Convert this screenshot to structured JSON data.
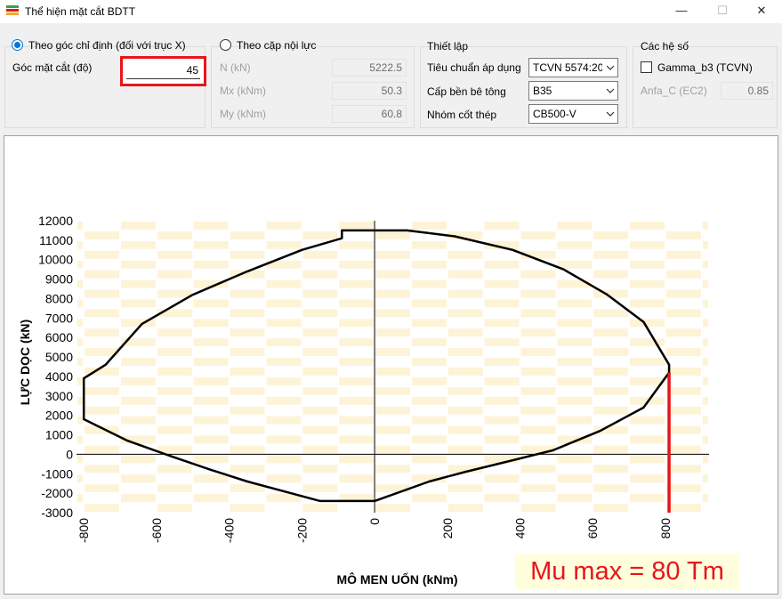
{
  "window": {
    "title": "Thể hiện mặt cắt BDTT",
    "minimize": "—",
    "maximize": "☐",
    "close": "✕"
  },
  "angle_group": {
    "radio_label": "Theo góc chỉ định (đối với trục X)",
    "selected": true,
    "angle_label": "Góc mặt cắt (độ)",
    "angle_value": "45"
  },
  "force_group": {
    "radio_label": "Theo cặp nội lực",
    "selected": false,
    "fields": [
      {
        "label": "N (kN)",
        "value": "5222.5"
      },
      {
        "label": "Mx (kNm)",
        "value": "50.3"
      },
      {
        "label": "My (kNm)",
        "value": "60.8"
      }
    ]
  },
  "settings_group": {
    "title": "Thiết lập",
    "rows": [
      {
        "label": "Tiêu chuẩn áp dụng",
        "value": "TCVN 5574:20"
      },
      {
        "label": "Cấp bền bê tông",
        "value": "B35"
      },
      {
        "label": "Nhóm cốt thép",
        "value": "CB500-V"
      }
    ]
  },
  "coeff_group": {
    "title": "Các hệ số",
    "checkbox_label": "Gamma_b3 (TCVN)",
    "checked": false,
    "anfa_label": "Anfa_C (EC2)",
    "anfa_value": "0.85"
  },
  "chart_data": {
    "type": "line",
    "xlabel": "MÔ MEN UỐN (kNm)",
    "ylabel": "LỰC DỌC (kN)",
    "xlim": [
      -820,
      920
    ],
    "ylim": [
      -3000,
      12000
    ],
    "xticks": [
      "-800",
      "-600",
      "-400",
      "-200",
      "0",
      "200",
      "400",
      "600",
      "800"
    ],
    "yticks": [
      "12000",
      "11000",
      "10000",
      "9000",
      "8000",
      "7000",
      "6000",
      "5000",
      "4000",
      "3000",
      "2000",
      "1000",
      "0",
      "-1000",
      "-2000",
      "-3000"
    ],
    "grid": true,
    "series": [
      {
        "x": [
          -90,
          90,
          220,
          380,
          520,
          640,
          740,
          810,
          810,
          740,
          620,
          490,
          360,
          250,
          150,
          0,
          -150,
          -250,
          -350,
          -450,
          -560,
          -680,
          -800,
          -800,
          -740,
          -640,
          -500,
          -350,
          -200,
          -90
        ],
        "y": [
          11500,
          11500,
          11200,
          10500,
          9500,
          8200,
          6800,
          4600,
          4200,
          2400,
          1200,
          200,
          -400,
          -900,
          -1400,
          -2400,
          -2400,
          -1900,
          -1400,
          -800,
          -100,
          700,
          1800,
          3900,
          4600,
          6700,
          8200,
          9400,
          10500,
          11100
        ]
      }
    ],
    "annotation": {
      "x": 810,
      "y_from": -3000,
      "y_to": 4200,
      "color": "#e8141b"
    }
  },
  "mu_label": "Mu max = 80 Tm",
  "colors": {
    "highlight_red": "#e8141b",
    "grid_fill": "#fdf3d6",
    "radio_accent": "#0078d7"
  }
}
